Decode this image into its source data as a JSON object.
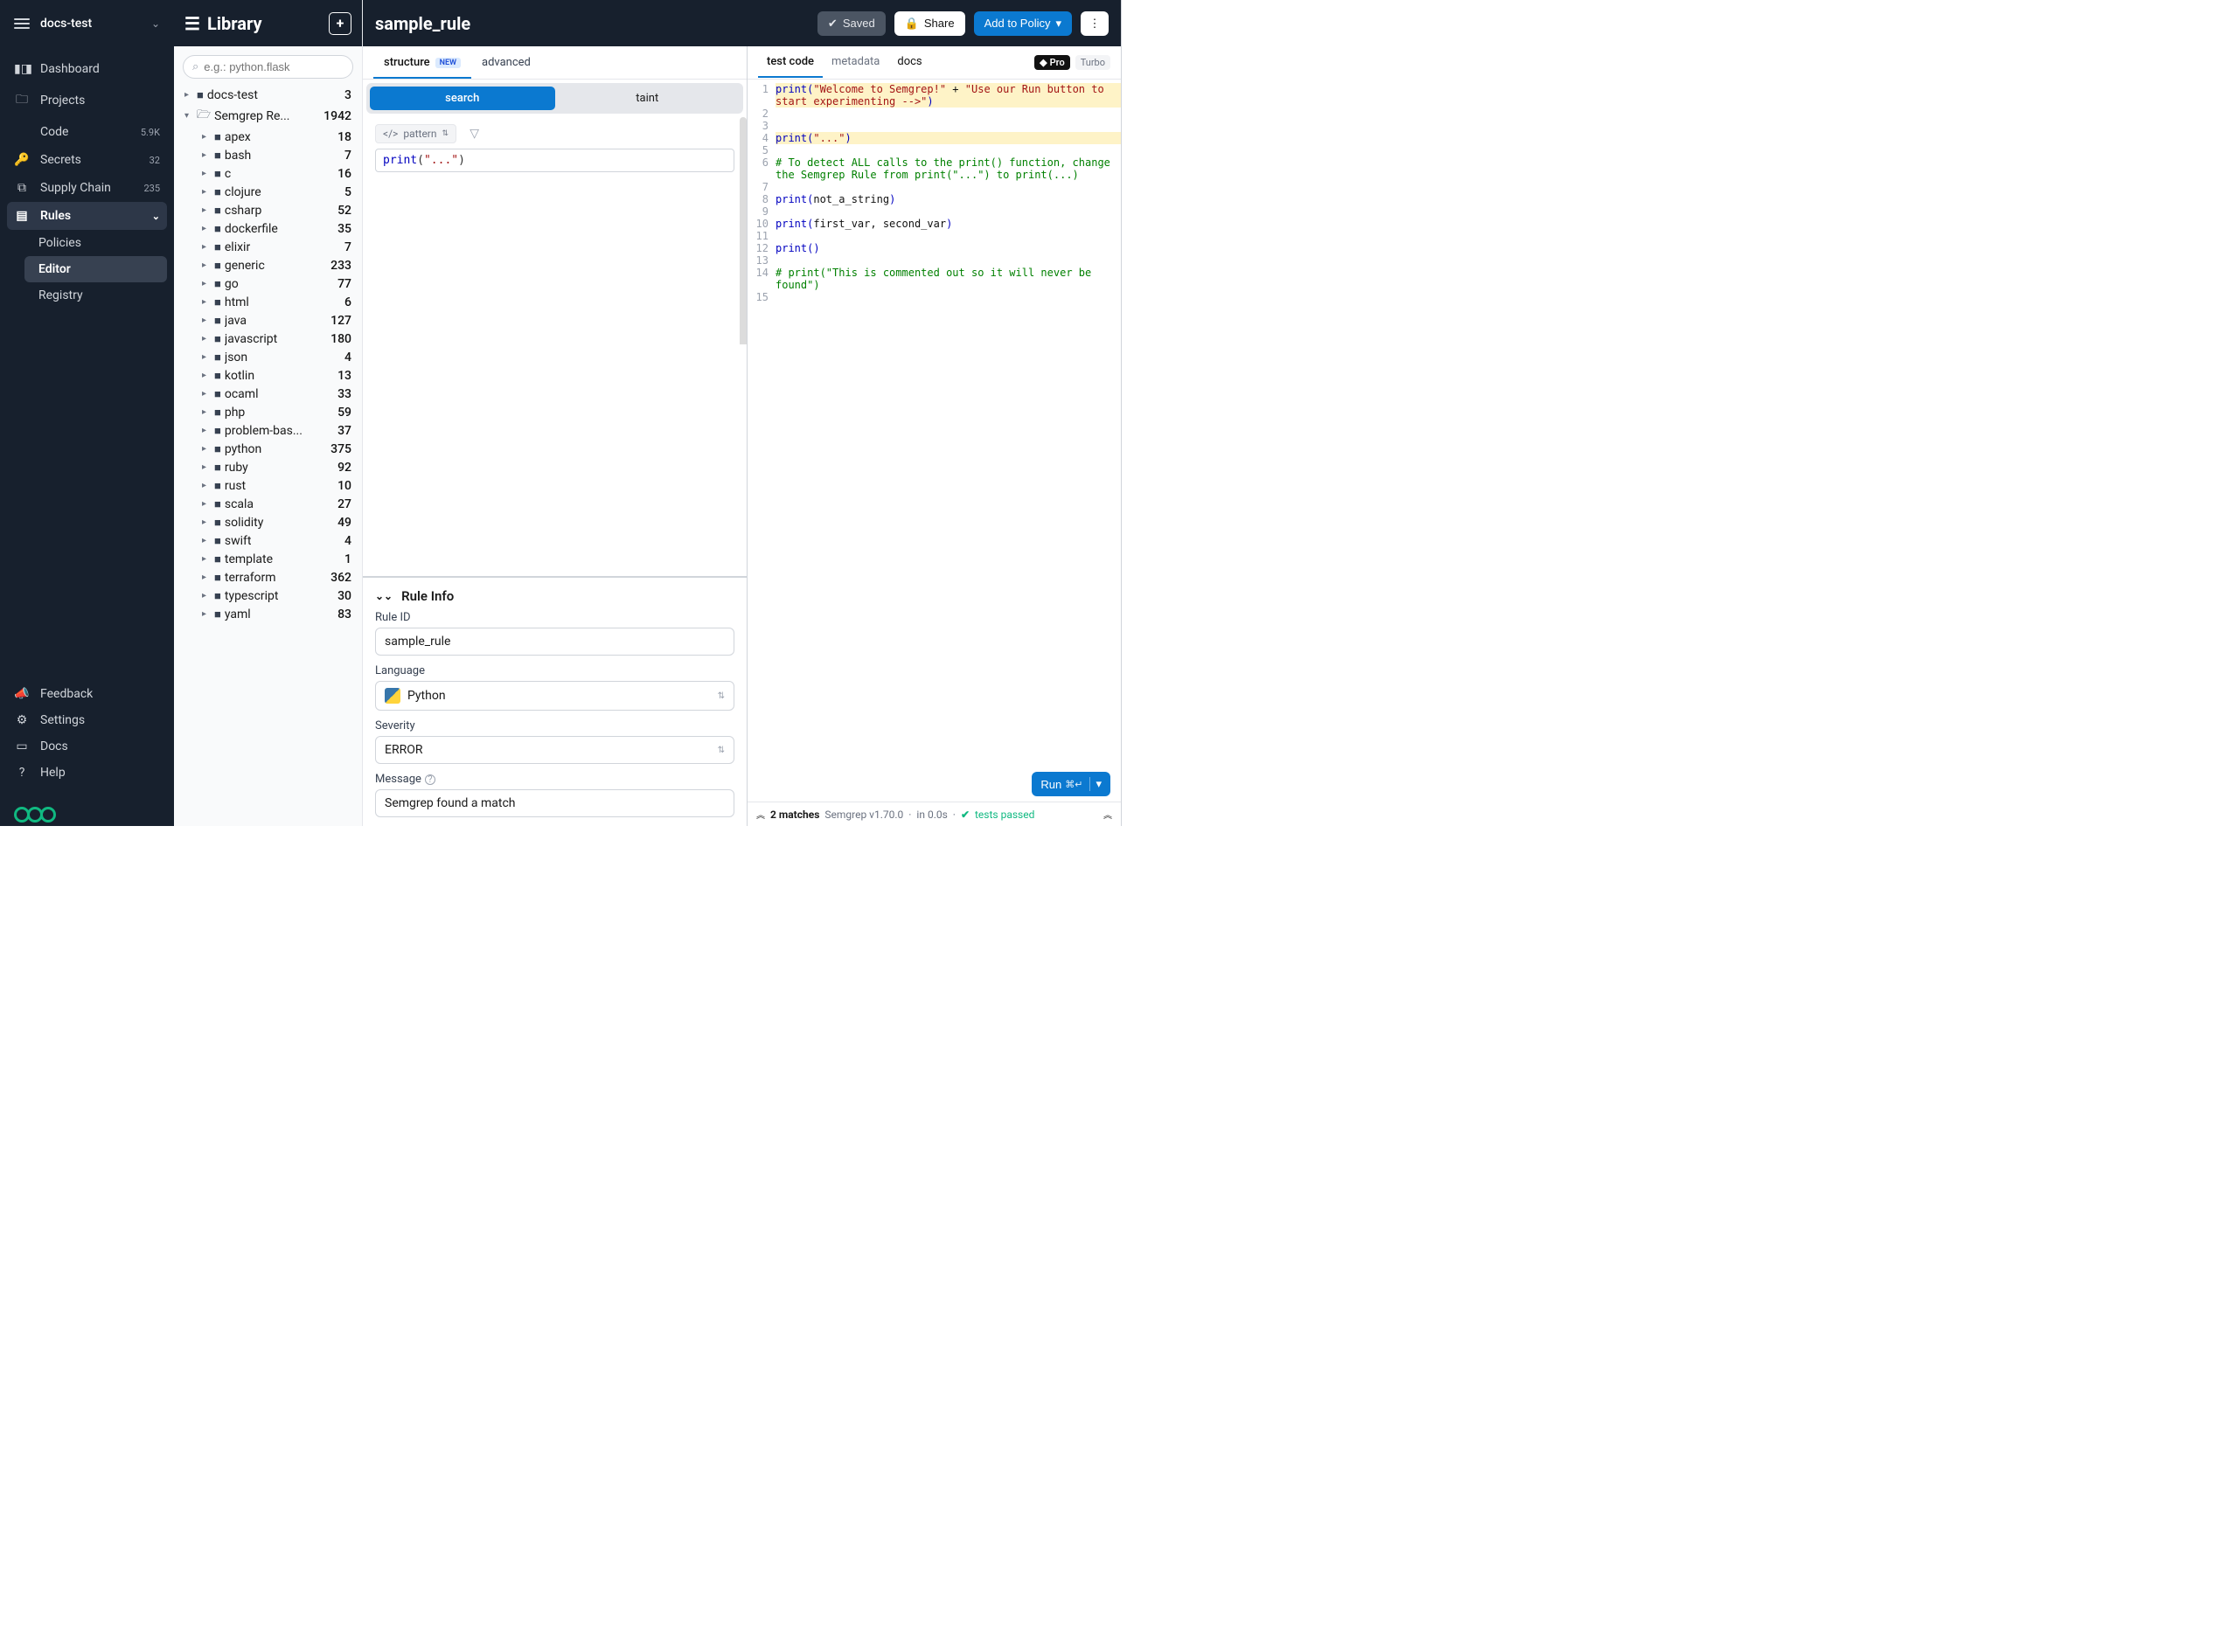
{
  "header": {
    "org": "docs-test"
  },
  "sidebar": {
    "nav": [
      {
        "icon": "chart",
        "label": "Dashboard",
        "count": ""
      },
      {
        "icon": "folder",
        "label": "Projects",
        "count": ""
      },
      {
        "icon": "code",
        "label": "Code",
        "count": "5.9K"
      },
      {
        "icon": "key",
        "label": "Secrets",
        "count": "32"
      },
      {
        "icon": "link",
        "label": "Supply Chain",
        "count": "235"
      },
      {
        "icon": "rules",
        "label": "Rules",
        "count": "",
        "active": true,
        "expandable": true,
        "sub": [
          {
            "label": "Policies"
          },
          {
            "label": "Editor",
            "active": true
          },
          {
            "label": "Registry"
          }
        ]
      }
    ],
    "footer": [
      {
        "icon": "mega",
        "label": "Feedback"
      },
      {
        "icon": "gear",
        "label": "Settings"
      },
      {
        "icon": "book",
        "label": "Docs"
      },
      {
        "icon": "help",
        "label": "Help"
      }
    ]
  },
  "library": {
    "title": "Library",
    "search_placeholder": "e.g.: python.flask",
    "tree": [
      {
        "depth": 0,
        "name": "docs-test",
        "count": 3,
        "icon": "folder-solid",
        "open": false
      },
      {
        "depth": 0,
        "name": "Semgrep Re...",
        "count": 1942,
        "icon": "folder-open",
        "open": true
      },
      {
        "depth": 1,
        "name": "apex",
        "count": 18
      },
      {
        "depth": 1,
        "name": "bash",
        "count": 7
      },
      {
        "depth": 1,
        "name": "c",
        "count": 16
      },
      {
        "depth": 1,
        "name": "clojure",
        "count": 5
      },
      {
        "depth": 1,
        "name": "csharp",
        "count": 52
      },
      {
        "depth": 1,
        "name": "dockerfile",
        "count": 35
      },
      {
        "depth": 1,
        "name": "elixir",
        "count": 7
      },
      {
        "depth": 1,
        "name": "generic",
        "count": 233
      },
      {
        "depth": 1,
        "name": "go",
        "count": 77
      },
      {
        "depth": 1,
        "name": "html",
        "count": 6
      },
      {
        "depth": 1,
        "name": "java",
        "count": 127
      },
      {
        "depth": 1,
        "name": "javascript",
        "count": 180
      },
      {
        "depth": 1,
        "name": "json",
        "count": 4
      },
      {
        "depth": 1,
        "name": "kotlin",
        "count": 13
      },
      {
        "depth": 1,
        "name": "ocaml",
        "count": 33
      },
      {
        "depth": 1,
        "name": "php",
        "count": 59
      },
      {
        "depth": 1,
        "name": "problem-bas...",
        "count": 37
      },
      {
        "depth": 1,
        "name": "python",
        "count": 375
      },
      {
        "depth": 1,
        "name": "ruby",
        "count": 92
      },
      {
        "depth": 1,
        "name": "rust",
        "count": 10
      },
      {
        "depth": 1,
        "name": "scala",
        "count": 27
      },
      {
        "depth": 1,
        "name": "solidity",
        "count": 49
      },
      {
        "depth": 1,
        "name": "swift",
        "count": 4
      },
      {
        "depth": 1,
        "name": "template",
        "count": 1
      },
      {
        "depth": 1,
        "name": "terraform",
        "count": 362
      },
      {
        "depth": 1,
        "name": "typescript",
        "count": 30
      },
      {
        "depth": 1,
        "name": "yaml",
        "count": 83
      }
    ]
  },
  "editor": {
    "title": "sample_rule",
    "saved_label": "Saved",
    "share_label": "Share",
    "policy_label": "Add to Policy",
    "tabs": {
      "structure": "structure",
      "new_badge": "NEW",
      "advanced": "advanced"
    },
    "mode": {
      "search": "search",
      "taint": "taint"
    },
    "pattern_selector": "pattern",
    "pattern_value": {
      "fn": "print",
      "str": "\"...\""
    },
    "rule_info": {
      "heading": "Rule Info",
      "id_label": "Rule ID",
      "id_value": "sample_rule",
      "lang_label": "Language",
      "lang_value": "Python",
      "sev_label": "Severity",
      "sev_value": "ERROR",
      "msg_label": "Message",
      "msg_value": "Semgrep found a match"
    }
  },
  "tests": {
    "tabs": {
      "test_code": "test code",
      "metadata": "metadata",
      "docs": "docs"
    },
    "pro": "Pro",
    "turbo": "Turbo",
    "run_label": "Run",
    "run_kbd": "⌘↵",
    "code": [
      {
        "n": 1,
        "hl": true,
        "tokens": [
          [
            "fn",
            "print"
          ],
          [
            "paren",
            "("
          ],
          [
            "str",
            "\"Welcome to Semgrep!\""
          ],
          [
            "id",
            " + "
          ],
          [
            "str",
            "\"Use our Run button to start experimenting -->\""
          ],
          [
            "paren",
            ")"
          ]
        ]
      },
      {
        "n": 2,
        "tokens": []
      },
      {
        "n": 3,
        "tokens": []
      },
      {
        "n": 4,
        "hl": true,
        "tokens": [
          [
            "fn",
            "print"
          ],
          [
            "paren",
            "("
          ],
          [
            "str",
            "\"...\""
          ],
          [
            "paren",
            ")"
          ]
        ]
      },
      {
        "n": 5,
        "tokens": []
      },
      {
        "n": 6,
        "tokens": [
          [
            "cmt",
            "# To detect ALL calls to the print() function, change the Semgrep Rule from print(\"...\") to print(...)"
          ]
        ]
      },
      {
        "n": 7,
        "tokens": []
      },
      {
        "n": 8,
        "tokens": [
          [
            "fn",
            "print"
          ],
          [
            "paren",
            "("
          ],
          [
            "id",
            "not_a_string"
          ],
          [
            "paren",
            ")"
          ]
        ]
      },
      {
        "n": 9,
        "tokens": []
      },
      {
        "n": 10,
        "tokens": [
          [
            "fn",
            "print"
          ],
          [
            "paren",
            "("
          ],
          [
            "id",
            "first_var, second_var"
          ],
          [
            "paren",
            ")"
          ]
        ]
      },
      {
        "n": 11,
        "tokens": []
      },
      {
        "n": 12,
        "tokens": [
          [
            "fn",
            "print"
          ],
          [
            "paren",
            "("
          ],
          [
            "paren",
            ")"
          ]
        ]
      },
      {
        "n": 13,
        "tokens": []
      },
      {
        "n": 14,
        "tokens": [
          [
            "cmt",
            "# print(\"This is commented out so it will never be found\")"
          ]
        ]
      },
      {
        "n": 15,
        "tokens": []
      }
    ],
    "status": {
      "matches": "2 matches",
      "version": "Semgrep v1.70.0",
      "time": "in 0.0s",
      "passed": "tests passed"
    }
  }
}
